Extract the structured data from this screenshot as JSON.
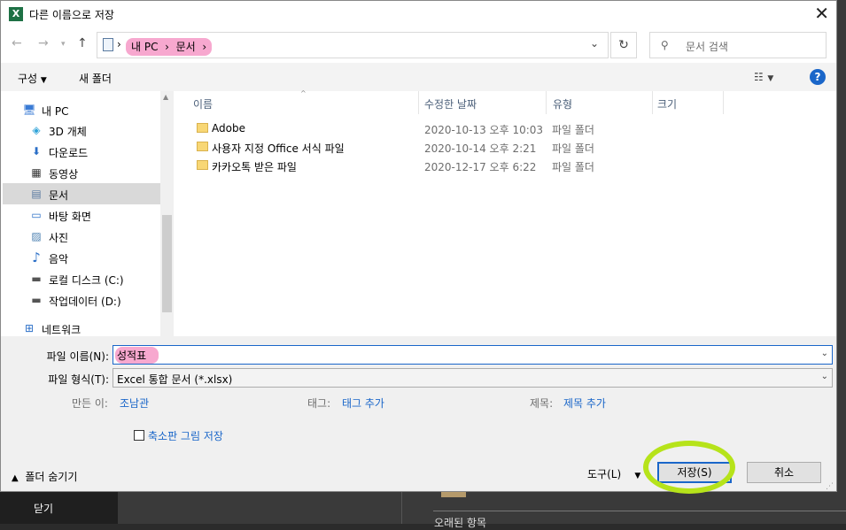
{
  "window": {
    "title": "다른 이름으로 저장"
  },
  "address": {
    "crumbs": [
      "내 PC",
      "문서"
    ]
  },
  "search": {
    "placeholder": "문서 검색"
  },
  "toolbar": {
    "organize": "구성",
    "new_folder": "새 폴더"
  },
  "nav": {
    "items": [
      {
        "label": "내 PC",
        "icon": "pc-icon",
        "glyph": "🖥"
      },
      {
        "label": "3D 개체",
        "icon": "cube-icon",
        "glyph": "◈"
      },
      {
        "label": "다운로드",
        "icon": "download-icon",
        "glyph": "⬇"
      },
      {
        "label": "동영상",
        "icon": "video-icon",
        "glyph": "▦"
      },
      {
        "label": "문서",
        "icon": "document-icon",
        "glyph": "▤"
      },
      {
        "label": "바탕 화면",
        "icon": "desktop-icon",
        "glyph": "▭"
      },
      {
        "label": "사진",
        "icon": "picture-icon",
        "glyph": "▨"
      },
      {
        "label": "음악",
        "icon": "music-icon",
        "glyph": "♪"
      },
      {
        "label": "로컬 디스크 (C:)",
        "icon": "drive-icon",
        "glyph": "▬"
      },
      {
        "label": "작업데이터 (D:)",
        "icon": "drive-icon",
        "glyph": "▬"
      },
      {
        "label": "네트워크",
        "icon": "network-icon",
        "glyph": "⊞"
      }
    ]
  },
  "columns": {
    "name": "이름",
    "modified": "수정한 날짜",
    "type": "유형",
    "size": "크기"
  },
  "files": [
    {
      "name": "Adobe",
      "modified": "2020-10-13 오후 10:03",
      "type": "파일 폴더"
    },
    {
      "name": "사용자 지정 Office 서식 파일",
      "modified": "2020-10-14 오후 2:21",
      "type": "파일 폴더"
    },
    {
      "name": "카카오톡 받은 파일",
      "modified": "2020-12-17 오후 6:22",
      "type": "파일 폴더"
    }
  ],
  "form": {
    "filename_label": "파일 이름(N):",
    "filename_value": "성적표",
    "filetype_label": "파일 형식(T):",
    "filetype_value": "Excel 통합 문서 (*.xlsx)",
    "author_label": "만든 이:",
    "author_value": "조남관",
    "tags_label": "태그:",
    "tags_value": "태그 추가",
    "title_label": "제목:",
    "title_value": "제목 추가",
    "thumbnail_label": "축소판 그림 저장",
    "thumbnail_checked": false
  },
  "footer": {
    "hide_folders": "폴더 숨기기",
    "tools": "도구(L)",
    "save": "저장(S)",
    "cancel": "취소"
  },
  "background": {
    "close_label": "닫기",
    "partial_text": "오래된 항목"
  },
  "colors": {
    "accent": "#1a66c9",
    "highlight_pink": "#f7a8cf",
    "annotation_lime": "#b6e31a",
    "excel_green": "#1e7145"
  }
}
